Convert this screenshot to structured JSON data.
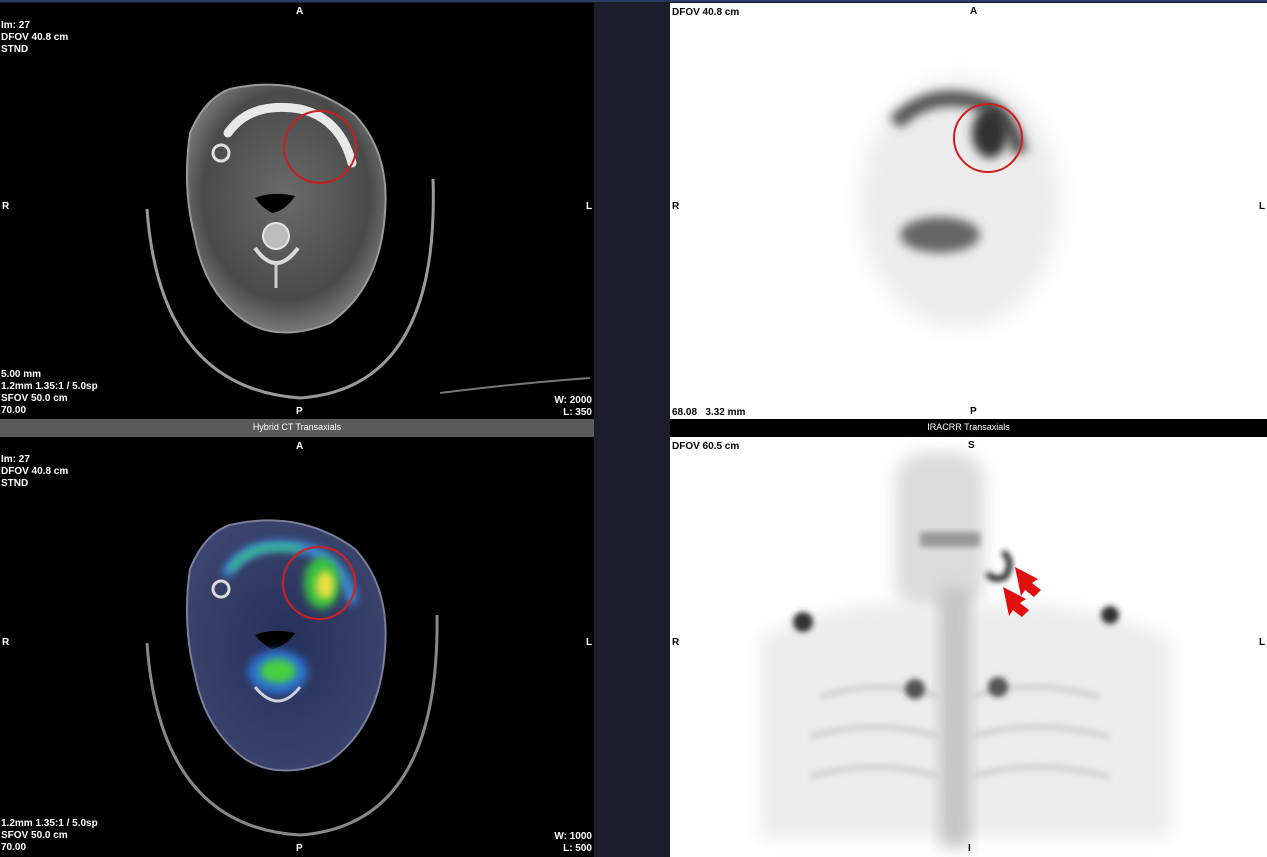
{
  "viewports": {
    "ct": {
      "top_left": [
        "Im: 27",
        "DFOV 40.8 cm",
        "STND"
      ],
      "bottom_left": [
        "5.00 mm",
        "1.2mm 1.35:1 / 5.0sp",
        "SFOV 50.0 cm",
        "70.00"
      ],
      "bottom_right": [
        "W: 2000",
        "L: 350"
      ],
      "orient": {
        "top": "A",
        "bottom": "P",
        "left": "R",
        "right": "L"
      }
    },
    "pet_axial": {
      "top_left": [
        "DFOV 40.8 cm"
      ],
      "bottom_left": [
        "68.08   3.32 mm"
      ],
      "orient": {
        "top": "A",
        "bottom": "P",
        "left": "R",
        "right": "L"
      }
    },
    "fusion": {
      "top_left": [
        "Im: 27",
        "DFOV 40.8 cm",
        "STND"
      ],
      "bottom_left": [
        "1.2mm 1.35:1 / 5.0sp",
        "SFOV 50.0 cm",
        "70.00"
      ],
      "bottom_right": [
        "W: 1000",
        "L: 500"
      ],
      "orient": {
        "top": "A",
        "bottom": "P",
        "left": "R",
        "right": "L"
      }
    },
    "mip": {
      "top_left": [
        "DFOV 60.5 cm"
      ],
      "orient": {
        "top": "S",
        "bottom": "I",
        "left": "R",
        "right": "L"
      }
    }
  },
  "strips": {
    "left": "Hybrid CT Transaxials",
    "right": "IRACRR Transaxials"
  },
  "colors": {
    "annotation_circle": "#d42020",
    "annotation_arrow": "#e01010"
  }
}
